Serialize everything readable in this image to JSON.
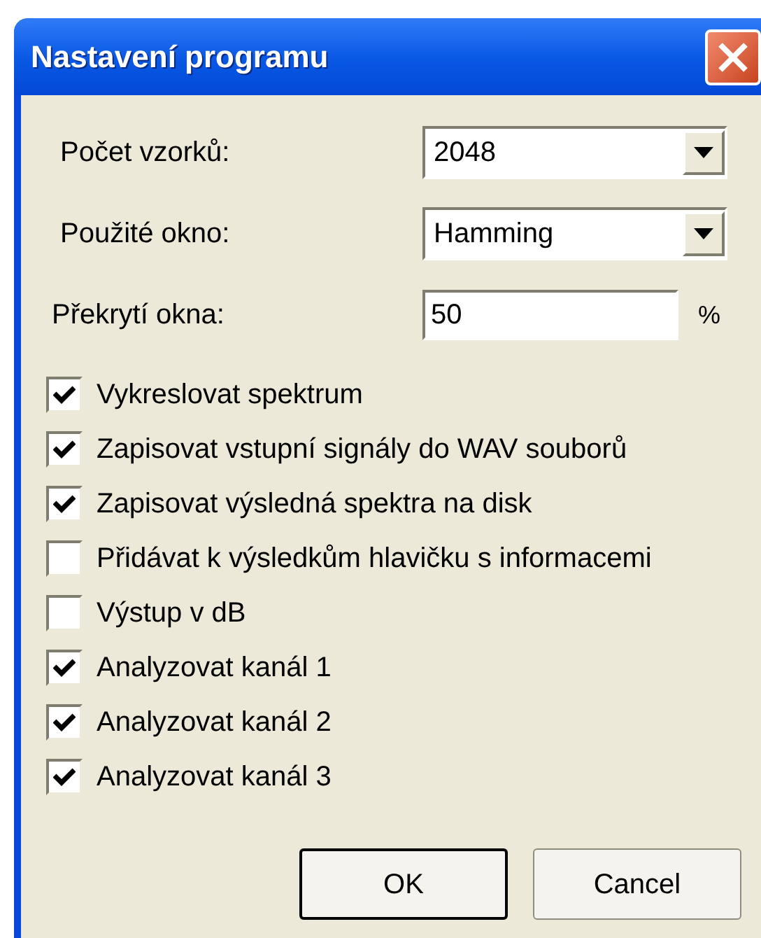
{
  "window": {
    "title": "Nastavení programu"
  },
  "fields": [
    {
      "kind": "combo",
      "label": "Počet vzorků:",
      "value": "2048"
    },
    {
      "kind": "combo",
      "label": "Použité okno:",
      "value": "Hamming"
    },
    {
      "kind": "text",
      "label": "Překrytí okna:",
      "value": "50",
      "unit": "%"
    }
  ],
  "options": [
    {
      "label": "Vykreslovat spektrum",
      "checked": true
    },
    {
      "label": "Zapisovat vstupní signály do WAV souborů",
      "checked": true
    },
    {
      "label": "Zapisovat výsledná spektra na disk",
      "checked": true
    },
    {
      "label": "Přidávat k výsledkům hlavičku s informacemi",
      "checked": false
    },
    {
      "label": "Výstup v dB",
      "checked": false
    },
    {
      "label": "Analyzovat kanál 1",
      "checked": true
    },
    {
      "label": "Analyzovat kanál 2",
      "checked": true
    },
    {
      "label": "Analyzovat kanál 3",
      "checked": true
    }
  ],
  "buttons": [
    "OK",
    "Cancel"
  ]
}
